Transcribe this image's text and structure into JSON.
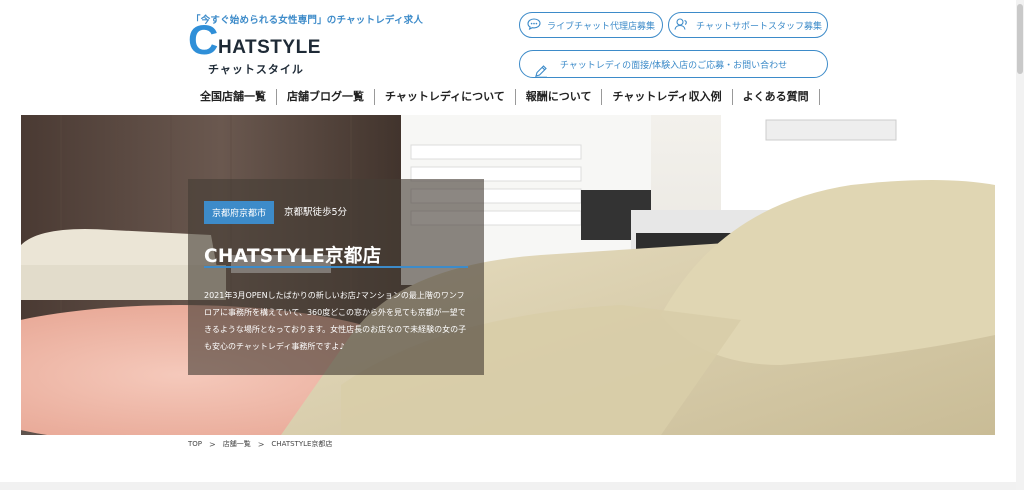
{
  "header": {
    "tagline": "「今すぐ始められる女性専門」のチャットレディ求人",
    "logo": {
      "big_c": "C",
      "rest": "HATSTYLE",
      "kana": "チャットスタイル"
    },
    "buttons": {
      "agency": "ライブチャット代理店募集",
      "support": "チャットサポートスタッフ募集",
      "inquiry": "チャットレディの面接/体験入店のご応募・お問い合わせ"
    }
  },
  "nav": [
    {
      "label": "全国店舗一覧"
    },
    {
      "label": "店舗ブログ一覧"
    },
    {
      "label": "チャットレディについて"
    },
    {
      "label": "報酬について"
    },
    {
      "label": "チャットレディ収入例"
    },
    {
      "label": "よくある質問"
    }
  ],
  "hero": {
    "location_tag": "京都府京都市",
    "station": "京都駅徒歩5分",
    "title": "CHATSTYLE京都店",
    "description": "2021年3月OPENしたばかりの新しいお店♪マンションの最上階のワンフロアに事務所を構えていて、360度どこの窓から外を見ても京都が一望できるような場所となっております。女性店長のお店なので未経験の女の子も安心のチャットレディ事務所ですよ♪"
  },
  "breadcrumb": {
    "home": "TOP",
    "sep": ">",
    "list": "店舗一覧",
    "current": "CHATSTYLE京都店"
  },
  "colors": {
    "accent": "#3d8bc9",
    "panel": "rgba(70,62,54,0.62)"
  },
  "icons": {
    "agency": "chat-bubble-icon",
    "support": "support-staff-icon",
    "inquiry": "pencil-icon"
  }
}
